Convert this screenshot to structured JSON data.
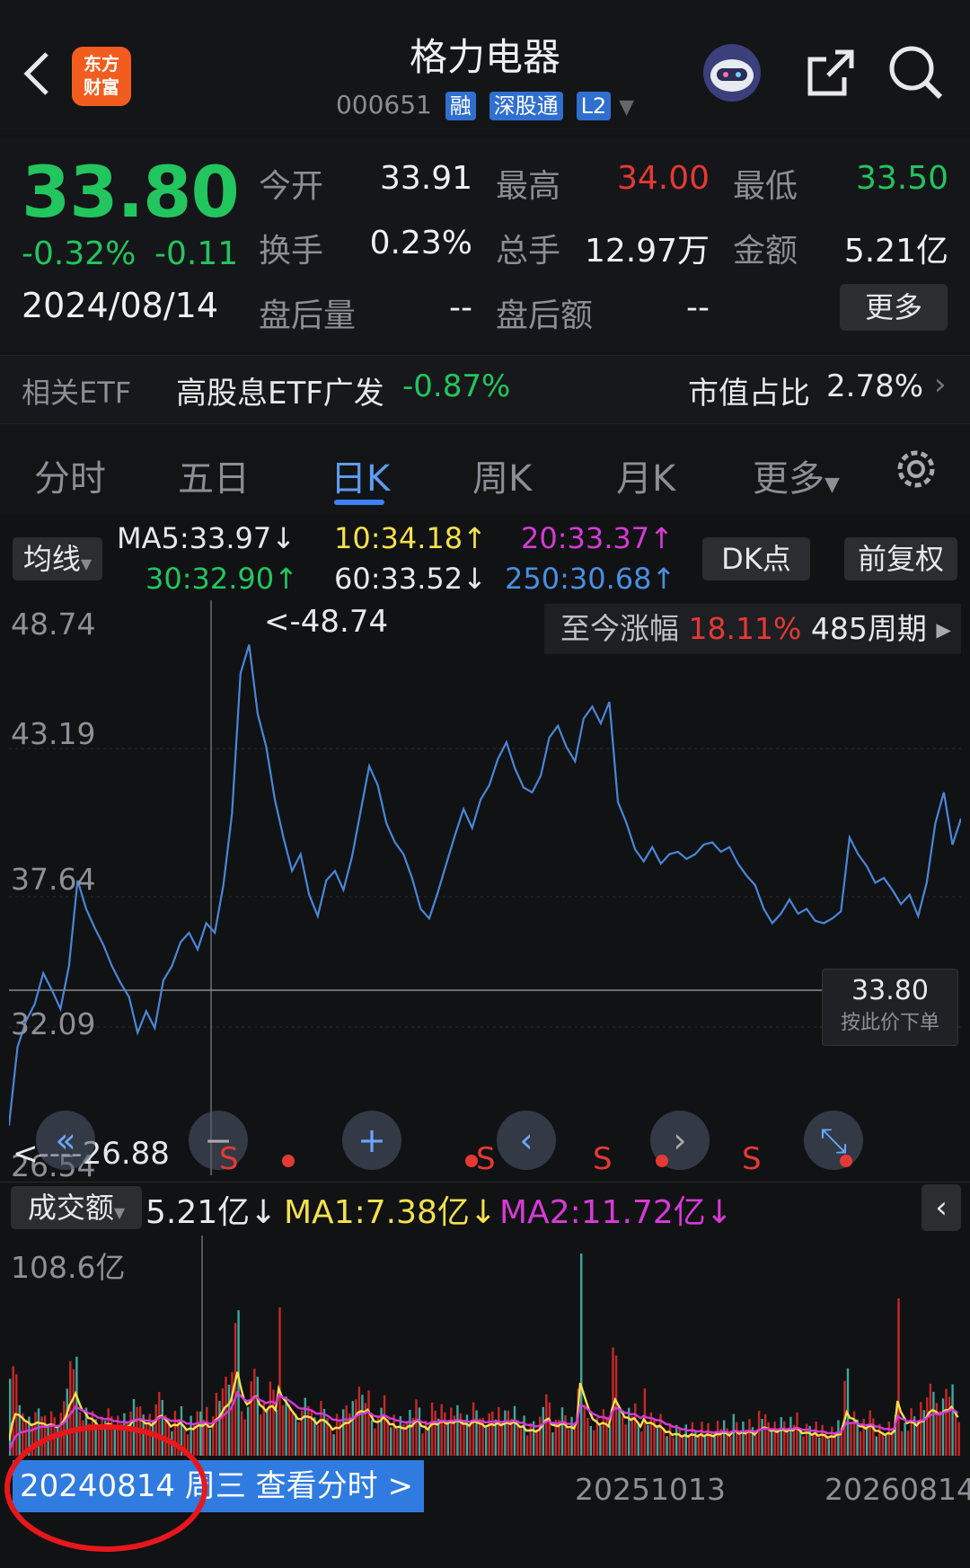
{
  "header": {
    "title": "格力电器",
    "code": "000651",
    "tags": [
      "融",
      "深股通",
      "L2"
    ],
    "logo_text": "东方 财富"
  },
  "quote": {
    "price": "33.80",
    "change_pct": "-0.32%",
    "change": "-0.11",
    "date": "2024/08/14",
    "open_label": "今开",
    "open": "33.91",
    "high_label": "最高",
    "high": "34.00",
    "low_label": "最低",
    "low": "33.50",
    "turnover_label": "换手",
    "turnover": "0.23%",
    "volume_label": "总手",
    "volume": "12.97万",
    "amount_label": "金额",
    "amount": "5.21亿",
    "after_vol_label": "盘后量",
    "after_vol": "--",
    "after_amt_label": "盘后额",
    "after_amt": "--",
    "more": "更多"
  },
  "etf": {
    "label": "相关ETF",
    "name": "高股息ETF广发",
    "change": "-0.87%",
    "ratio_label": "市值占比",
    "ratio": "2.78%"
  },
  "tabs": [
    "分时",
    "五日",
    "日K",
    "周K",
    "月K",
    "更多"
  ],
  "active_tab": 2,
  "ma": {
    "selector": "均线",
    "ma5": "MA5:33.97↓",
    "ma10": "10:34.18↑",
    "ma20": "20:33.37↑",
    "ma30": "30:32.90↑",
    "ma60": "60:33.52↓",
    "ma250": "250:30.68↑",
    "dk": "DK点",
    "adjust": "前复权"
  },
  "chart": {
    "y_labels": [
      "48.74",
      "43.19",
      "37.64",
      "32.09",
      "26.54"
    ],
    "max_marker": "<-48.74",
    "min_marker": "<----26.88",
    "gain_label": "至今涨幅",
    "gain_value": "18.11%",
    "gain_periods": "485周期",
    "cross_price": "33.80",
    "cross_order": "按此价下单",
    "signal_s": "S"
  },
  "volume": {
    "selector": "成交额",
    "value": "5.21亿↓",
    "ma1": "MA1:7.38亿↓",
    "ma2": "MA2:11.72亿↓",
    "y_max": "108.6亿"
  },
  "footer": {
    "cursor_date": "20240814 周三 查看分时 >",
    "x_mid": "20251013",
    "x_end": "20260814"
  },
  "colors": {
    "up": "#e53935",
    "down": "#22c55e",
    "line": "#4a86d8",
    "ma1": "#f4e04d",
    "ma2": "#d63ad6"
  },
  "chart_data": {
    "type": "line",
    "ylim": [
      26.54,
      48.74
    ],
    "series": [
      {
        "values": [
          27.5,
          30.8,
          31.9,
          32.6,
          33.9,
          33.2,
          32.4,
          34.2,
          37.8,
          36.6,
          35.8,
          35.1,
          34.2,
          33.5,
          32.9,
          31.4,
          32.3,
          31.6,
          33.6,
          34.2,
          35.2,
          35.6,
          34.9,
          36.0,
          35.6,
          37.6,
          40.6,
          46.5,
          47.7,
          44.8,
          43.4,
          41.2,
          39.6,
          38.2,
          38.9,
          37.2,
          36.3,
          37.8,
          38.2,
          37.4,
          38.8,
          40.7,
          42.6,
          41.8,
          40.2,
          39.4,
          38.9,
          37.9,
          36.6,
          36.2,
          37.3,
          38.5,
          39.7,
          40.8,
          40.0,
          41.2,
          41.8,
          42.9,
          43.6,
          42.5,
          41.7,
          41.5,
          42.2,
          43.8,
          44.3,
          43.4,
          42.8,
          44.6,
          45.1,
          44.4,
          45.3,
          41.1,
          40.2,
          39.1,
          38.6,
          39.2,
          38.5,
          38.9,
          39.0,
          38.7,
          38.9,
          39.3,
          39.4,
          39.0,
          39.2,
          38.5,
          38.0,
          37.6,
          36.6,
          36.0,
          36.4,
          37.0,
          36.4,
          36.6,
          36.1,
          36.0,
          36.2,
          36.5,
          39.6,
          38.9,
          38.4,
          37.7,
          37.9,
          37.4,
          36.8,
          37.2,
          36.3,
          37.7,
          40.2,
          41.5,
          39.3,
          40.4
        ]
      }
    ]
  }
}
